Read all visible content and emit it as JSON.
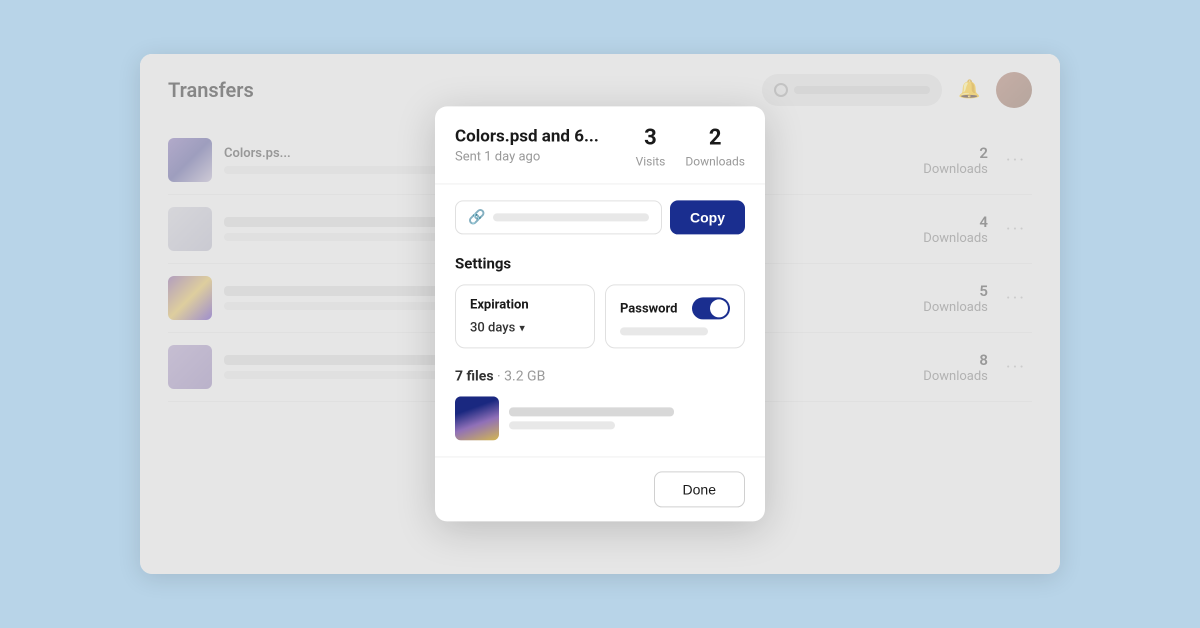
{
  "app": {
    "title": "Transfers",
    "search_placeholder": "Search"
  },
  "modal": {
    "title": "Colors.psd and 6...",
    "subtitle": "Sent 1 day ago",
    "stats": {
      "visits_count": "3",
      "visits_label": "Visits",
      "downloads_count": "2",
      "downloads_label": "Downloads"
    },
    "link_placeholder": "",
    "copy_button": "Copy",
    "settings": {
      "label": "Settings",
      "expiration": {
        "title": "Expiration",
        "value": "30 days"
      },
      "password": {
        "title": "Password"
      }
    },
    "files": {
      "count": "7 files",
      "size": "3.2 GB"
    },
    "done_button": "Done"
  },
  "transfers": [
    {
      "name": "Colors.ps...",
      "downloads_count": "2",
      "downloads_label": "Downloads"
    },
    {
      "name": "",
      "downloads_count": "4",
      "downloads_label": "Downloads"
    },
    {
      "name": "",
      "downloads_count": "5",
      "downloads_label": "Downloads"
    },
    {
      "name": "",
      "downloads_count": "8",
      "downloads_label": "Downloads"
    }
  ]
}
